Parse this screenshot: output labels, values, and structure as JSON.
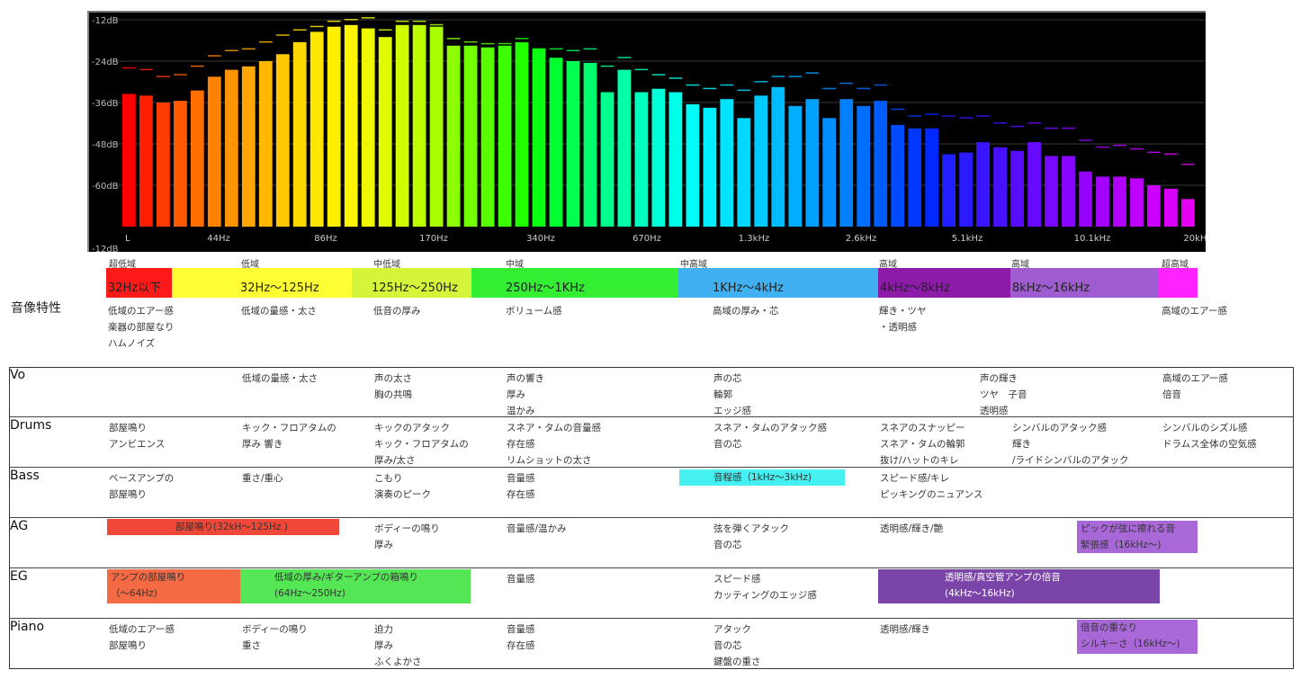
{
  "chart_data": {
    "type": "bar",
    "y_ticks": [
      "-12dB",
      "-24dB",
      "-36dB",
      "-48dB",
      "-60dB",
      "-12dB"
    ],
    "ylim": [
      -72,
      -12
    ],
    "x_ticks": [
      "L",
      "44Hz",
      "86Hz",
      "170Hz",
      "340Hz",
      "670Hz",
      "1.3kHz",
      "2.6kHz",
      "5.1kHz",
      "10.1kHz",
      "20kHz"
    ],
    "grid": true,
    "values": [
      -33.5,
      -34,
      -36,
      -35.5,
      -32.5,
      -28.5,
      -26.5,
      -25.5,
      -24,
      -22,
      -18.5,
      -15.5,
      -14,
      -13.5,
      -14.5,
      -17,
      -13.5,
      -13.5,
      -14,
      -19.5,
      -19.5,
      -20,
      -19.5,
      -18.5,
      -20.5,
      -23,
      -24,
      -24.5,
      -33,
      -26.5,
      -33,
      -32,
      -33,
      -36.5,
      -37.5,
      -35,
      -40.5,
      -34,
      -31.5,
      -37,
      -35,
      -40.5,
      -35,
      -37,
      -35.5,
      -42.5,
      -43.5,
      -43.5,
      -51,
      -50.5,
      -47.5,
      -49,
      -50,
      -47.5,
      -51.5,
      -51.5,
      -56,
      -57.5,
      -57.5,
      -58,
      -60,
      -61,
      -64
    ],
    "peaks": [
      -26,
      -26.5,
      -28.5,
      -28,
      -25.5,
      -22.5,
      -21,
      -20.5,
      -18.5,
      -16.5,
      -15,
      -14,
      -12.5,
      -12,
      -11.5,
      -15,
      -12.5,
      -12.5,
      -13.5,
      -17.5,
      -18.5,
      -19,
      -19,
      -17.5,
      -20.5,
      -20.5,
      -21,
      -20.5,
      -25.5,
      -23,
      -26.5,
      -28,
      -29,
      -31,
      -32,
      -31,
      -32.5,
      -30,
      -28.5,
      -28.5,
      -27.5,
      -32,
      -30.5,
      -32,
      -31,
      -38,
      -40,
      -39.5,
      -40,
      -40.5,
      -40,
      -42,
      -43,
      -42,
      -43.5,
      -43.5,
      -47,
      -49,
      -48.5,
      -49.5,
      -50.5,
      -51,
      -54
    ],
    "colors": [
      "#ff0000",
      "#ff1e00",
      "#ff3c00",
      "#ff5a00",
      "#ff7000",
      "#ff8200",
      "#ff9400",
      "#ffa600",
      "#ffb800",
      "#ffc800",
      "#ffd800",
      "#ffe600",
      "#fff000",
      "#fdf600",
      "#f0f800",
      "#e2fa00",
      "#d0fc00",
      "#bcff00",
      "#a8ff00",
      "#8cff00",
      "#72ff00",
      "#58ff00",
      "#3cff00",
      "#22ff00",
      "#0aff10",
      "#00ff30",
      "#00ff50",
      "#00ff6e",
      "#00ff8c",
      "#00ffa8",
      "#00ffc0",
      "#00ffd6",
      "#00ffe8",
      "#00fcf8",
      "#00f0ff",
      "#00e4ff",
      "#00d8ff",
      "#00caff",
      "#00bcff",
      "#00aeff",
      "#00a0ff",
      "#0090ff",
      "#0080ff",
      "#006eff",
      "#005cff",
      "#004aff",
      "#0038ff",
      "#0028ff",
      "#2020ff",
      "#2c1aff",
      "#3814ff",
      "#4810ff",
      "#580cff",
      "#680aff",
      "#7808ff",
      "#8806ff",
      "#9604ff",
      "#a404ff",
      "#b202ff",
      "#c000ff",
      "#cc00ff",
      "#d800f8",
      "#e400f0"
    ]
  },
  "bands": [
    {
      "name": "超低域",
      "range": "32Hz以下",
      "color": "#ff1a1a"
    },
    {
      "name": "低域",
      "range": "32Hz〜125Hz",
      "color": "#ffff33"
    },
    {
      "name": "中低域",
      "range": "125Hz〜250Hz",
      "color": "#d4f53a"
    },
    {
      "name": "中域",
      "range": "250Hz〜1KHz",
      "color": "#33ee33"
    },
    {
      "name": "中高域",
      "range": "1KHz〜4kHz",
      "color": "#40b0f0"
    },
    {
      "name": "高域",
      "range": "4kHz〜8kHz",
      "color": "#8c1ca8"
    },
    {
      "name": "高域",
      "range": "8kHz〜16kHz",
      "color": "#9e5cd0"
    },
    {
      "name": "超高域",
      "range": "",
      "color": "#ff22ff"
    }
  ],
  "characteristics": {
    "title": "音像特性",
    "items": [
      "低域のエアー感\n楽器の部屋なり\nハムノイズ",
      "低域の量感・太さ",
      "低音の厚み",
      "ボリューム感",
      "高域の厚み・芯",
      "輝き・ツヤ\n・透明感",
      "高域のエアー感"
    ]
  },
  "instruments": {
    "vo": {
      "name": "Vo",
      "cells": [
        "低域の量感・太さ",
        "声の太さ\n胸の共鳴",
        "声の響き\n厚み\n温かみ",
        "声の芯\n輪郭\nエッジ感",
        "声の輝き\nツヤ　子音\n透明感",
        "高域のエアー感\n倍音"
      ]
    },
    "drums": {
      "name": "Drums",
      "cells": [
        "部屋鳴り\nアンビエンス",
        "キック・フロアタムの\n厚み 響き",
        "キックのアタック\nキック・フロアタムの\n厚み/太さ",
        "スネア・タムの音量感\n存在感\nリムショットの太さ",
        "スネア・タムのアタック感\n音の芯",
        "スネアのスナッピー\nスネア・タムの輪郭\n抜け/ハットのキレ",
        "シンバルのアタック感\n輝き\n/ライドシンバルのアタック",
        "シンバルのシズル感\nドラムス全体の空気感"
      ]
    },
    "bass": {
      "name": "Bass",
      "cells": [
        "ベースアンプの\n部屋鳴り",
        "重さ/重心",
        "こもり\n演奏のピーク",
        "音量感\n存在感",
        "スピード感/キレ\nピッキングのニュアンス"
      ],
      "highlight": "音程感（1kHz〜3kHz)",
      "highlight_color": "#44f0f0"
    },
    "ag": {
      "name": "AG",
      "cells": [
        "ボディーの鳴り\n厚み",
        "音量感/温かみ",
        "弦を弾くアタック\n音の芯",
        "透明感/輝き/艶"
      ],
      "highlight1": "部屋鳴り(32kH〜125Hz )",
      "highlight1_color": "#f04838",
      "highlight2": "ピックが弦に擦れる音\n緊張感（16kHz〜)",
      "highlight2_color": "#a868d8"
    },
    "eg": {
      "name": "EG",
      "cells": [
        "音量感",
        "スピード感\nカッティングのエッジ感"
      ],
      "highlight1": "アンプの部屋鳴り\n（〜64Hz)",
      "highlight1_color": "#f46a44",
      "highlight2": "低域の厚み/ギターアンプの箱鳴り\n(64Hz〜250Hz)",
      "highlight2_color": "#55e655",
      "highlight3": "透明感/真空管アンプの倍音\n(4kHz〜16kHz)",
      "highlight3_color": "#7a44a8"
    },
    "piano": {
      "name": "Piano",
      "cells": [
        "低域のエアー感\n部屋鳴り",
        "ボディーの鳴り\n重さ",
        "迫力\n厚み\nふくよかさ",
        "音量感\n存在感",
        "アタック\n音の芯\n鍵盤の重さ",
        "透明感/輝き"
      ],
      "highlight": "倍音の重なり\nシルキーさ（16kHz〜)",
      "highlight_color": "#a868d8"
    }
  }
}
